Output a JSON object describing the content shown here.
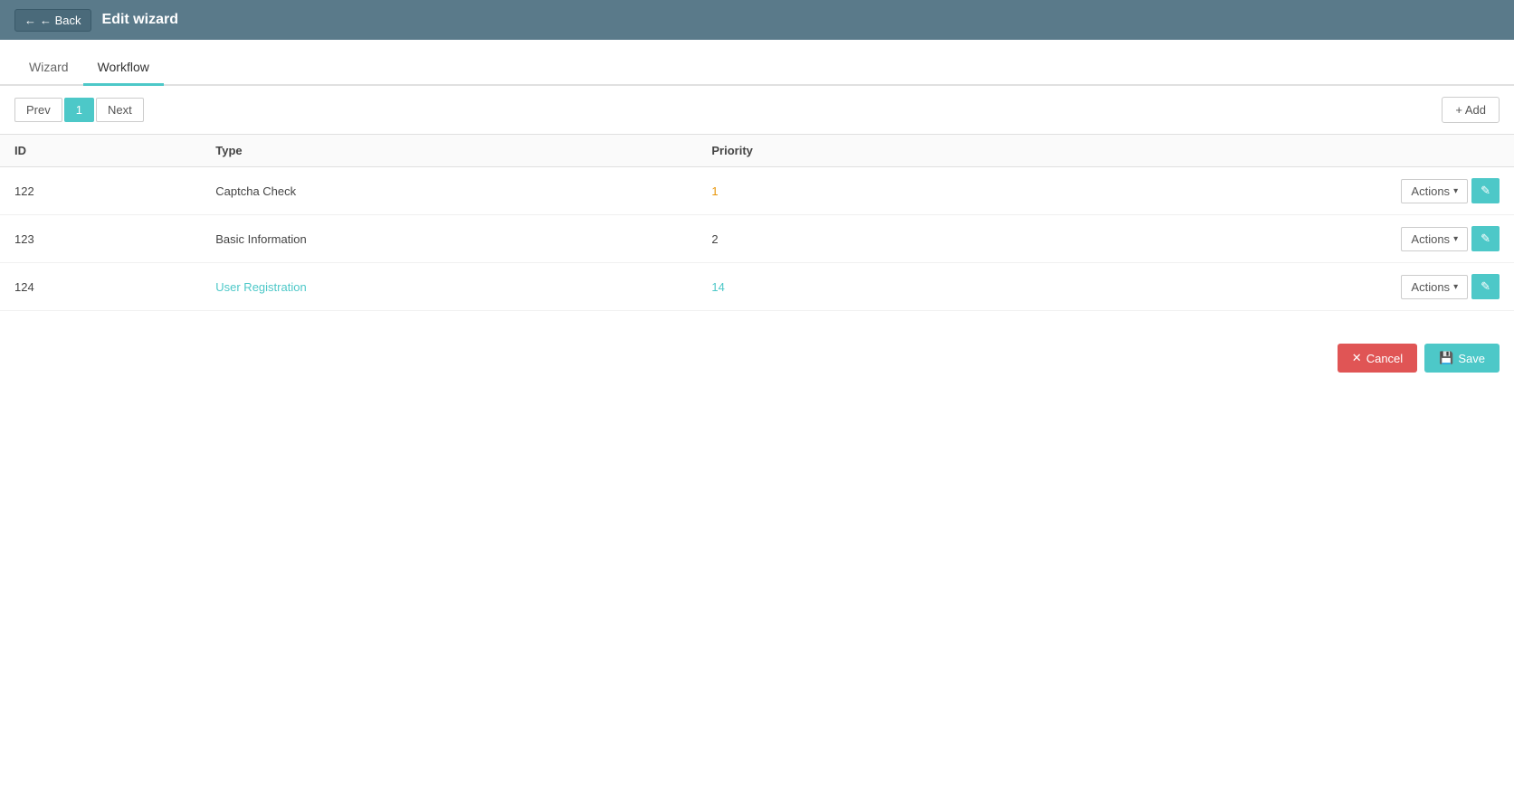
{
  "header": {
    "back_label": "← Back",
    "title": "Edit wizard"
  },
  "tabs": [
    {
      "id": "wizard",
      "label": "Wizard",
      "active": false
    },
    {
      "id": "workflow",
      "label": "Workflow",
      "active": true
    }
  ],
  "toolbar": {
    "prev_label": "Prev",
    "page_number": "1",
    "next_label": "Next",
    "add_label": "+ Add"
  },
  "table": {
    "columns": [
      "ID",
      "Type",
      "Priority"
    ],
    "rows": [
      {
        "id": "122",
        "type": "Captcha Check",
        "type_style": "normal",
        "priority": "1",
        "priority_style": "orange"
      },
      {
        "id": "123",
        "type": "Basic Information",
        "type_style": "normal",
        "priority": "2",
        "priority_style": "normal"
      },
      {
        "id": "124",
        "type": "User Registration",
        "type_style": "link",
        "priority": "14",
        "priority_style": "link"
      }
    ],
    "actions_label": "Actions",
    "actions_chevron": "▾"
  },
  "footer": {
    "cancel_label": "✕ Cancel",
    "save_label": "💾 Save"
  }
}
